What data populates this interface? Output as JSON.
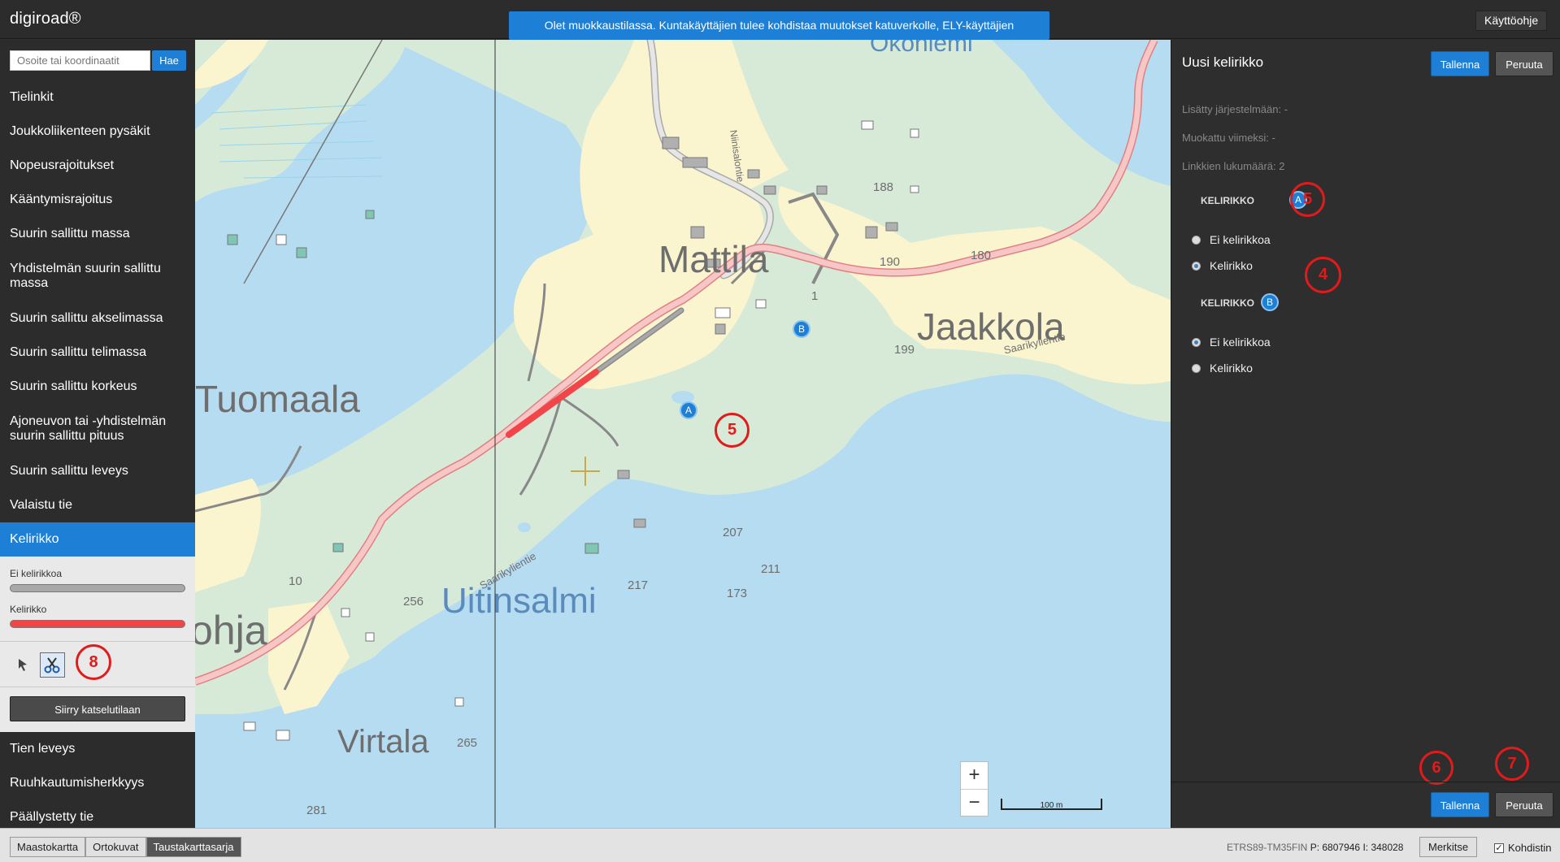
{
  "app": {
    "logo": "digiroad®",
    "notice": "Olet muokkaustilassa. Kuntakäyttäjien tulee kohdistaa muutokset katuverkolle, ELY-käyttäjien maantieverkolle.",
    "help": "Käyttöohje"
  },
  "search": {
    "placeholder": "Osoite tai koordinaatit",
    "button": "Hae"
  },
  "sidebar": {
    "items_top": [
      "Tielinkit",
      "Joukkoliikenteen pysäkit",
      "Nopeusrajoitukset",
      "Kääntymisrajoitus",
      "Suurin sallittu massa",
      "Yhdistelmän suurin sallittu massa",
      "Suurin sallittu akselimassa",
      "Suurin sallittu telimassa",
      "Suurin sallittu korkeus",
      "Ajoneuvon tai -yhdistelmän suurin sallittu pituus",
      "Suurin sallittu leveys",
      "Valaistu tie",
      "Kelirikko"
    ],
    "legend": [
      {
        "label": "Ei kelirikkoa",
        "color": "#a8a8a8"
      },
      {
        "label": "Kelirikko",
        "color": "#f2454a"
      }
    ],
    "mode_button": "Siirry katselutilaan",
    "items_bottom": [
      "Tien leveys",
      "Ruuhkautumisherkkyys",
      "Päällystetty tie"
    ]
  },
  "map": {
    "labels": {
      "okoniemi": "Okoniemi",
      "mattila": "Mattila",
      "jaakkola": "Jaakkola",
      "tuomaala": "Tuomaala",
      "uitinsalmi": "Uitinsalmi",
      "ohja": "ohja",
      "virtala": "Virtala",
      "niinisalontie": "Niinisalontie",
      "saarikylientie1": "Saarikylientie",
      "saarikylientie2": "Saarikylientie",
      "n188": "188",
      "n190": "190",
      "n180": "180",
      "n1": "1",
      "n199": "199",
      "n207": "207",
      "n211": "211",
      "n217": "217",
      "n173": "173",
      "n10": "10",
      "n256": "256",
      "n265": "265",
      "n281": "281"
    },
    "markers": {
      "a": "A",
      "b": "B"
    },
    "zoom_in": "+",
    "zoom_out": "−",
    "scale": "100 m"
  },
  "panel": {
    "title": "Uusi kelirikko",
    "save": "Tallenna",
    "cancel": "Peruuta",
    "added": "Lisätty järjestelmään: -",
    "modified": "Muokattu viimeksi: -",
    "links": "Linkkien lukumäärä: 2",
    "segment_a": {
      "header": "KELIRIKKO",
      "badge": "A",
      "options": [
        {
          "label": "Ei kelirikkoa",
          "checked": false
        },
        {
          "label": "Kelirikko",
          "checked": true
        }
      ]
    },
    "segment_b": {
      "header": "KELIRIKKO",
      "badge": "B",
      "options": [
        {
          "label": "Ei kelirikkoa",
          "checked": true
        },
        {
          "label": "Kelirikko",
          "checked": false
        }
      ]
    }
  },
  "annotations": {
    "a5map": "5",
    "a5panel": "5",
    "a4": "4",
    "a6": "6",
    "a7": "7",
    "a8": "8"
  },
  "bottom": {
    "layers": [
      {
        "label": "Maastokartta",
        "active": false
      },
      {
        "label": "Ortokuvat",
        "active": false
      },
      {
        "label": "Taustakarttasarja",
        "active": true
      }
    ],
    "crs": "ETRS89-TM35FIN",
    "p": "P: 6807946",
    "i": "I: 348028",
    "mark": "Merkitse",
    "center_label": "Kohdistin",
    "center_checked": true
  },
  "colors": {
    "accent": "#1e7fd6",
    "kelirikko": "#f2454a",
    "ei_kelirikkoa": "#a8a8a8",
    "annotation": "#e11b1b"
  }
}
